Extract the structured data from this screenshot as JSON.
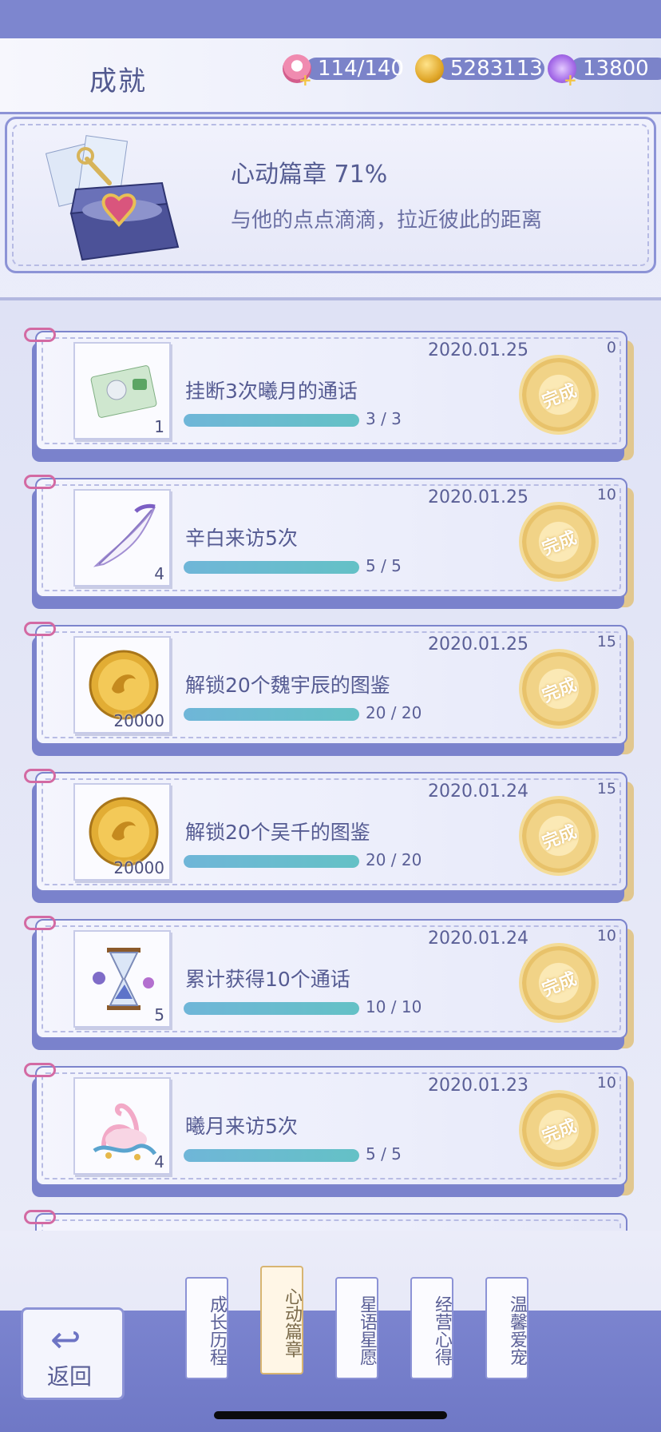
{
  "header": {
    "title": "成就",
    "resources": [
      {
        "icon": "cake-icon",
        "value": "114/140"
      },
      {
        "icon": "coin-icon",
        "value": "5283113"
      },
      {
        "icon": "wing-icon",
        "value": "13800"
      }
    ]
  },
  "banner": {
    "title": "心动篇章 71%",
    "subtitle": "与他的点点滴滴，拉近彼此的距离",
    "icon": "treasure-chest-icon"
  },
  "stamp_label": "完成",
  "achievements": [
    {
      "name": "挂断3次曦月的通话",
      "date": "2020.01.25",
      "points": "0",
      "reward_qty": "1",
      "progress_text": "3 / 3",
      "progress": 1.0,
      "icon": "ticket-icon"
    },
    {
      "name": "辛白来访5次",
      "date": "2020.01.25",
      "points": "10",
      "reward_qty": "4",
      "progress_text": "5 / 5",
      "progress": 1.0,
      "icon": "feather-icon"
    },
    {
      "name": "解锁20个魏宇辰的图鉴",
      "date": "2020.01.25",
      "points": "15",
      "reward_qty": "20000",
      "progress_text": "20 / 20",
      "progress": 1.0,
      "icon": "gold-coin-icon"
    },
    {
      "name": "解锁20个吴千的图鉴",
      "date": "2020.01.24",
      "points": "15",
      "reward_qty": "20000",
      "progress_text": "20 / 20",
      "progress": 1.0,
      "icon": "gold-coin-icon"
    },
    {
      "name": "累计获得10个通话",
      "date": "2020.01.24",
      "points": "10",
      "reward_qty": "5",
      "progress_text": "10 / 10",
      "progress": 1.0,
      "icon": "hourglass-icon"
    },
    {
      "name": "曦月来访5次",
      "date": "2020.01.23",
      "points": "10",
      "reward_qty": "4",
      "progress_text": "5 / 5",
      "progress": 1.0,
      "icon": "swan-icon"
    }
  ],
  "tabs": [
    {
      "label": "成长历程",
      "active": false
    },
    {
      "label": "心动篇章",
      "active": true
    },
    {
      "label": "星语星愿",
      "active": false
    },
    {
      "label": "经营心得",
      "active": false
    },
    {
      "label": "温馨爱宠",
      "active": false
    }
  ],
  "back_button": {
    "label": "返回"
  },
  "colors": {
    "accent": "#7c84cc",
    "progress": "#64c1c6",
    "stamp": "#f1d387"
  }
}
